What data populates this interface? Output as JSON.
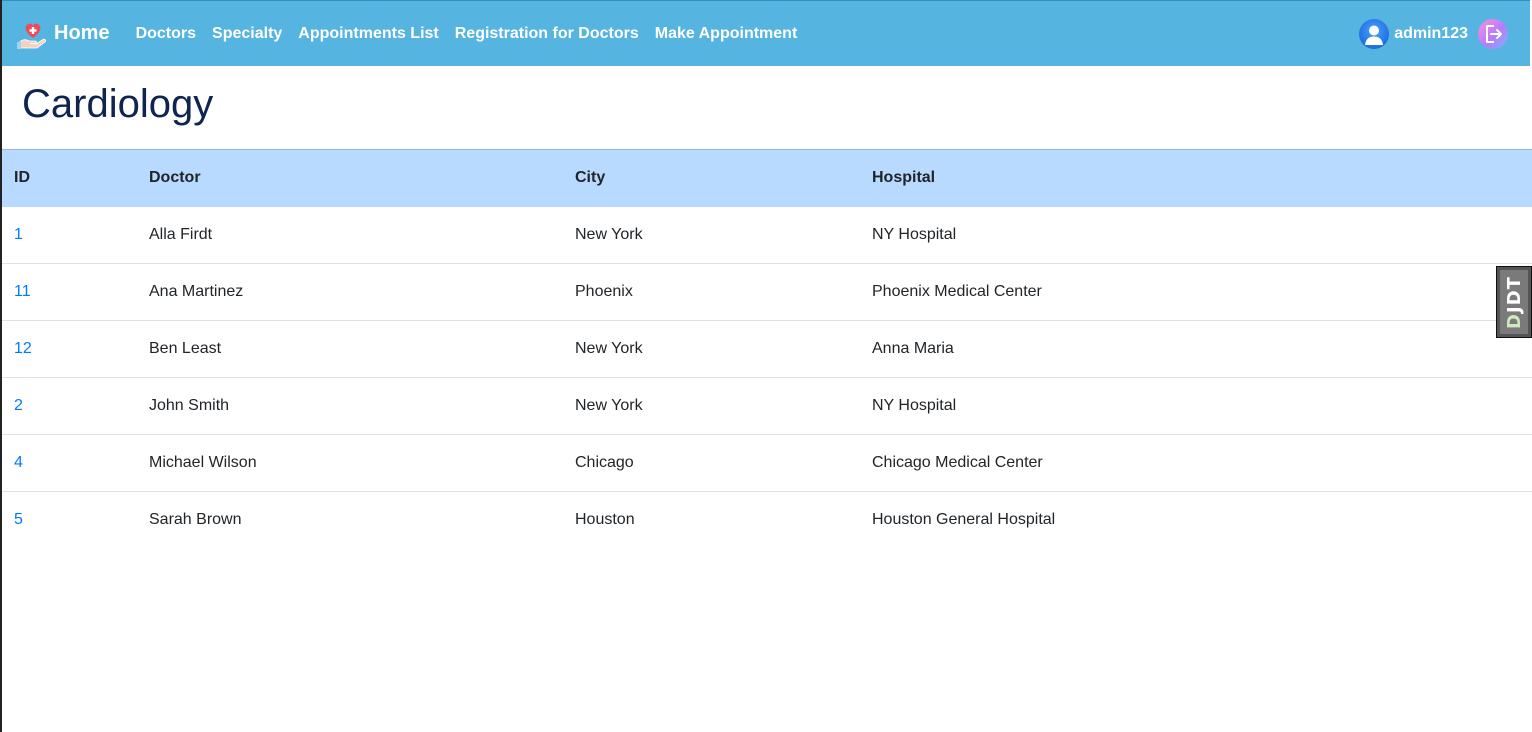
{
  "navbar": {
    "brand_label": "Home",
    "links": [
      {
        "label": "Doctors"
      },
      {
        "label": "Specialty"
      },
      {
        "label": "Appointments List"
      },
      {
        "label": "Registration for Doctors"
      },
      {
        "label": "Make Appointment"
      }
    ],
    "username": "admin123",
    "colors": {
      "background": "#56b4e0",
      "text": "#ffffff"
    },
    "icons": {
      "brand": "heart-hand-icon",
      "user": "user-avatar-icon",
      "logout": "logout-icon"
    }
  },
  "page": {
    "title": "Cardiology"
  },
  "table": {
    "headers": {
      "id": "ID",
      "doctor": "Doctor",
      "city": "City",
      "hospital": "Hospital"
    },
    "header_bg": "#b8daff",
    "rows": [
      {
        "id": "1",
        "doctor": "Alla Firdt",
        "city": "New York",
        "hospital": "NY Hospital"
      },
      {
        "id": "11",
        "doctor": "Ana Martinez",
        "city": "Phoenix",
        "hospital": "Phoenix Medical Center"
      },
      {
        "id": "12",
        "doctor": "Ben Least",
        "city": "New York",
        "hospital": "Anna Maria"
      },
      {
        "id": "2",
        "doctor": "John Smith",
        "city": "New York",
        "hospital": "NY Hospital"
      },
      {
        "id": "4",
        "doctor": "Michael Wilson",
        "city": "Chicago",
        "hospital": "Chicago Medical Center"
      },
      {
        "id": "5",
        "doctor": "Sarah Brown",
        "city": "Houston",
        "hospital": "Houston General Hospital"
      }
    ]
  },
  "djdt": {
    "label_d": "D",
    "label_rest": "JDT"
  }
}
